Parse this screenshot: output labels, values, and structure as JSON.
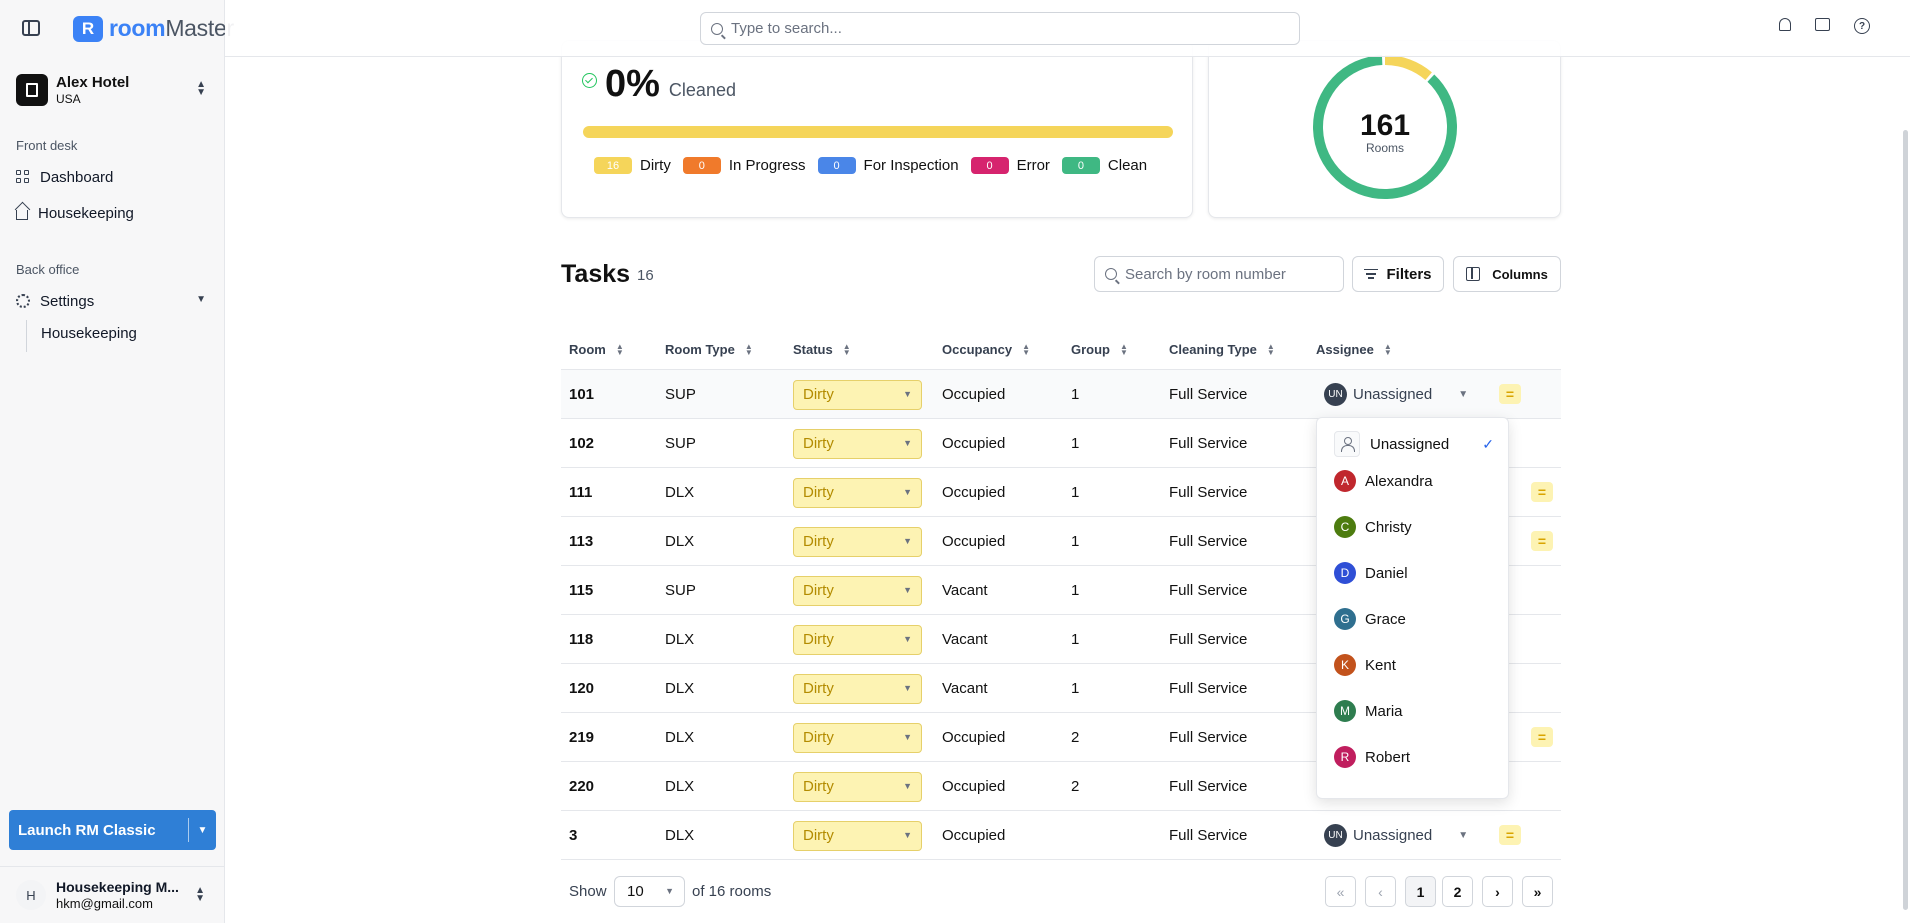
{
  "app": {
    "brand_prefix": "room",
    "brand_suffix": "Master"
  },
  "header": {
    "search_placeholder": "Type to search..."
  },
  "sidebar": {
    "hotel_name": "Alex Hotel",
    "hotel_country": "USA",
    "front_desk_label": "Front desk",
    "dashboard_label": "Dashboard",
    "housekeeping_label": "Housekeeping",
    "back_office_label": "Back office",
    "settings_label": "Settings",
    "settings_sub_housekeeping": "Housekeeping",
    "launch_label": "Launch RM Classic",
    "user_initial": "H",
    "user_name": "Housekeeping M...",
    "user_email": "hkm@gmail.com"
  },
  "stats": {
    "cleaned_percent": "0%",
    "cleaned_label": "Cleaned",
    "legend": [
      {
        "count": "16",
        "label": "Dirty",
        "color": "#f5d55a"
      },
      {
        "count": "0",
        "label": "In Progress",
        "color": "#f07a2b"
      },
      {
        "count": "0",
        "label": "For Inspection",
        "color": "#4a86e8"
      },
      {
        "count": "0",
        "label": "Error",
        "color": "#d6246e"
      },
      {
        "count": "0",
        "label": "Clean",
        "color": "#3fb883"
      }
    ],
    "rooms_total": "161",
    "rooms_label": "Rooms",
    "ring_fraction_clean": 0.88,
    "ring_fraction_dirty": 0.12
  },
  "tasks": {
    "title": "Tasks",
    "count": "16",
    "search_placeholder": "Search by room number",
    "filters_label": "Filters",
    "columns_label": "Columns",
    "columns": {
      "room": "Room",
      "room_type": "Room Type",
      "status": "Status",
      "occupancy": "Occupancy",
      "group": "Group",
      "cleaning_type": "Cleaning Type",
      "assignee": "Assignee"
    },
    "rows": [
      {
        "room": "101",
        "type": "SUP",
        "status": "Dirty",
        "occupancy": "Occupied",
        "group": "1",
        "cleaning": "Full Service",
        "assignee": "Unassigned"
      },
      {
        "room": "102",
        "type": "SUP",
        "status": "Dirty",
        "occupancy": "Occupied",
        "group": "1",
        "cleaning": "Full Service"
      },
      {
        "room": "111",
        "type": "DLX",
        "status": "Dirty",
        "occupancy": "Occupied",
        "group": "1",
        "cleaning": "Full Service"
      },
      {
        "room": "113",
        "type": "DLX",
        "status": "Dirty",
        "occupancy": "Occupied",
        "group": "1",
        "cleaning": "Full Service"
      },
      {
        "room": "115",
        "type": "SUP",
        "status": "Dirty",
        "occupancy": "Vacant",
        "group": "1",
        "cleaning": "Full Service"
      },
      {
        "room": "118",
        "type": "DLX",
        "status": "Dirty",
        "occupancy": "Vacant",
        "group": "1",
        "cleaning": "Full Service"
      },
      {
        "room": "120",
        "type": "DLX",
        "status": "Dirty",
        "occupancy": "Vacant",
        "group": "1",
        "cleaning": "Full Service"
      },
      {
        "room": "219",
        "type": "DLX",
        "status": "Dirty",
        "occupancy": "Occupied",
        "group": "2",
        "cleaning": "Full Service"
      },
      {
        "room": "220",
        "type": "DLX",
        "status": "Dirty",
        "occupancy": "Occupied",
        "group": "2",
        "cleaning": "Full Service"
      },
      {
        "room": "3",
        "type": "DLX",
        "status": "Dirty",
        "occupancy": "Occupied",
        "group": "",
        "cleaning": "Full Service",
        "assignee": "Unassigned"
      }
    ],
    "assignee_avatar": "UN"
  },
  "assignee_dropdown": {
    "options": [
      {
        "initial": "",
        "name": "Unassigned",
        "color": "",
        "selected": true
      },
      {
        "initial": "A",
        "name": "Alexandra",
        "color": "#c0272d"
      },
      {
        "initial": "C",
        "name": "Christy",
        "color": "#4d7c0f"
      },
      {
        "initial": "D",
        "name": "Daniel",
        "color": "#2f4fd6"
      },
      {
        "initial": "G",
        "name": "Grace",
        "color": "#2f6f8f"
      },
      {
        "initial": "K",
        "name": "Kent",
        "color": "#c2521c"
      },
      {
        "initial": "M",
        "name": "Maria",
        "color": "#2e7d4f"
      },
      {
        "initial": "R",
        "name": "Robert",
        "color": "#c01e5e"
      }
    ]
  },
  "pagination": {
    "show_label": "Show",
    "page_size": "10",
    "of_label": "of 16 rooms",
    "pages": [
      "1",
      "2"
    ],
    "first_icon": "«",
    "prev_icon": "‹",
    "next_icon": "›",
    "last_icon": "»"
  }
}
